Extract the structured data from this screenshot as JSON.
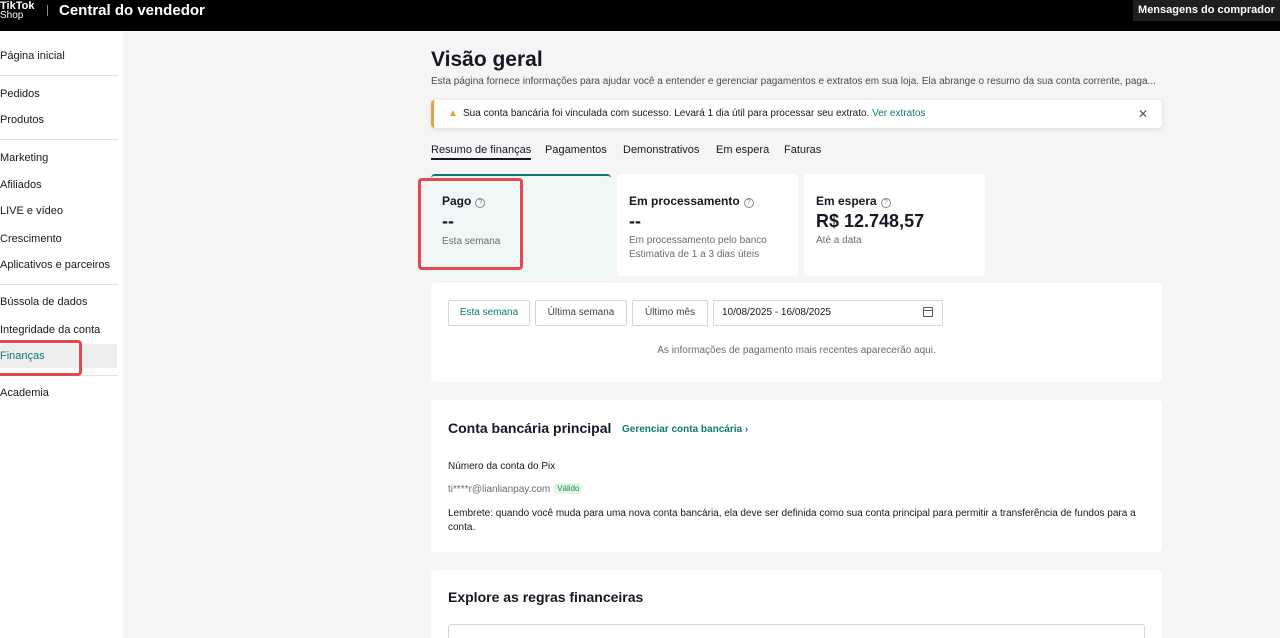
{
  "topbar": {
    "logo_line1": "TikTok",
    "logo_line2": "Shop",
    "title": "Central do vendedor",
    "messages_button": "Mensagens do comprador"
  },
  "sidebar": {
    "items": [
      {
        "label": "Página inicial"
      },
      {
        "label": "Pedidos"
      },
      {
        "label": "Produtos"
      },
      {
        "label": "Marketing"
      },
      {
        "label": "Afiliados"
      },
      {
        "label": "LIVE e vídeo"
      },
      {
        "label": "Crescimento"
      },
      {
        "label": "Aplicativos e parceiros"
      },
      {
        "label": "Bússola de dados"
      },
      {
        "label": "Integridade da conta"
      },
      {
        "label": "Finanças",
        "active": true
      },
      {
        "label": "Academia"
      }
    ]
  },
  "main": {
    "title": "Visão geral",
    "description": "Esta página fornece informações para ajudar você a entender e gerenciar pagamentos e extratos em sua loja. Ela abrange o resumo da sua conta corrente, paga...",
    "alert": {
      "icon": "warning-icon",
      "text": "Sua conta bancária foi vinculada com sucesso. Levará 1 dia útil para processar seu extrato.",
      "link": "Ver extratos",
      "close_icon": "close-icon"
    },
    "tabs": [
      {
        "label": "Resumo de finanças",
        "active": true
      },
      {
        "label": "Pagamentos"
      },
      {
        "label": "Demonstrativos"
      },
      {
        "label": "Em espera"
      },
      {
        "label": "Faturas"
      }
    ],
    "cards": [
      {
        "title": "Pago",
        "value": "--",
        "sub1": "Esta semana",
        "sub2": ""
      },
      {
        "title": "Em processamento",
        "value": "--",
        "sub1": "Em processamento pelo banco",
        "sub2": "Estimativa de 1 a 3 dias úteis"
      },
      {
        "title": "Em espera",
        "value": "R$ 12.748,57",
        "sub1": "Até a data",
        "sub2": ""
      }
    ],
    "filters": {
      "buttons": [
        "Esta semana",
        "Última semana",
        "Último mês"
      ],
      "date_range": "10/08/2025 - 16/08/2025",
      "empty_message": "As informações de pagamento mais recentes aparecerão aqui."
    },
    "bank": {
      "title": "Conta bancária principal",
      "manage_link": "Gerenciar conta bancária",
      "pix_label": "Número da conta do Pix",
      "email": "ti****r@lianlianpay.com",
      "badge": "Válido",
      "reminder": "Lembrete: quando você muda para uma nova conta bancária, ela deve ser definida como sua conta principal para permitir a transferência de fundos para a conta."
    },
    "rules": {
      "title": "Explore as regras financeiras"
    }
  },
  "colors": {
    "accent": "#0b7a75",
    "highlight": "#e5484d",
    "warning": "#e6a23c"
  }
}
